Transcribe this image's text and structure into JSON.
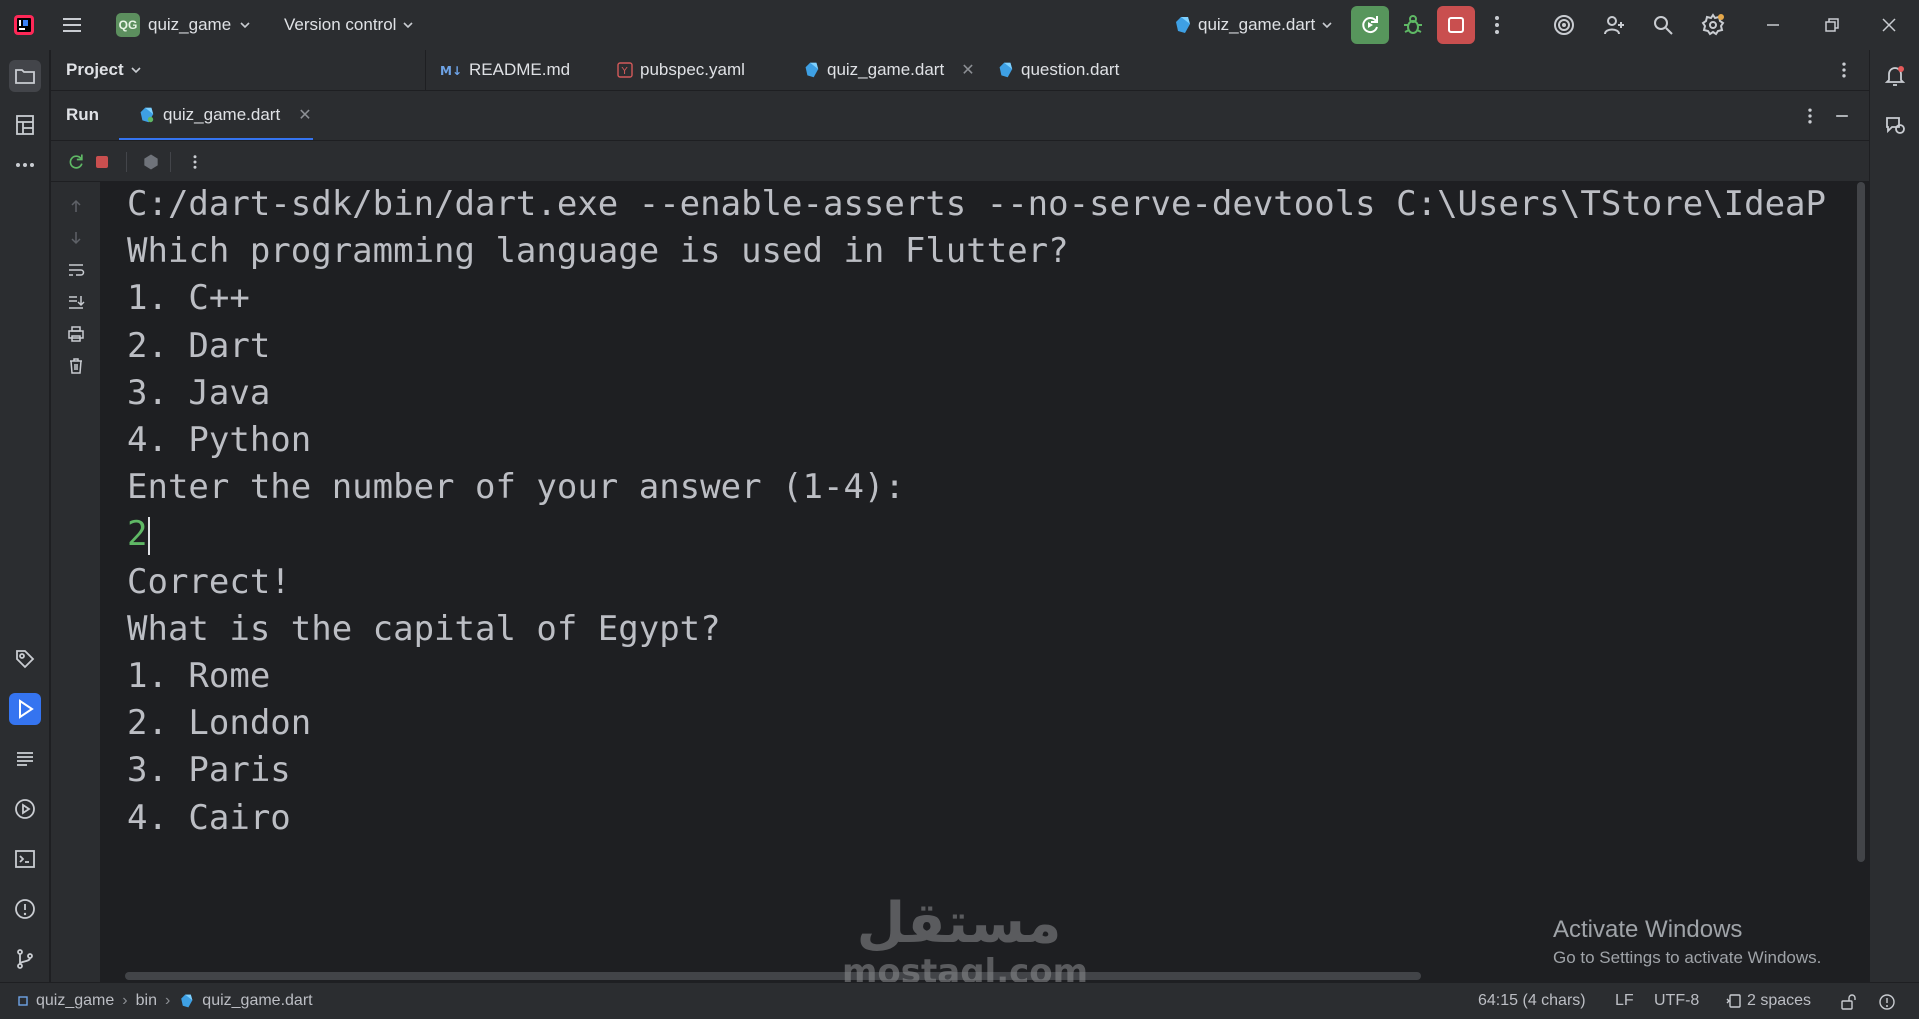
{
  "titlebar": {
    "project_badge": "QG",
    "project_name": "quiz_game",
    "vcs_label": "Version control",
    "run_config": "quiz_game.dart"
  },
  "project_panel": {
    "title": "Project"
  },
  "editor_tabs": [
    {
      "label": "README.md",
      "icon": "markdown-file-icon"
    },
    {
      "label": "pubspec.yaml",
      "icon": "yaml-file-icon"
    },
    {
      "label": "quiz_game.dart",
      "icon": "dart-file-icon",
      "active": true
    },
    {
      "label": "question.dart",
      "icon": "dart-file-icon"
    }
  ],
  "run_panel": {
    "title": "Run",
    "tab_label": "quiz_game.dart"
  },
  "console": {
    "lines": [
      {
        "text": "C:/dart-sdk/bin/dart.exe --enable-asserts --no-serve-devtools C:\\Users\\TStore\\IdeaP",
        "kind": "output"
      },
      {
        "text": "Which programming language is used in Flutter?",
        "kind": "output"
      },
      {
        "text": "1. C++",
        "kind": "output"
      },
      {
        "text": "2. Dart",
        "kind": "output"
      },
      {
        "text": "3. Java",
        "kind": "output"
      },
      {
        "text": "4. Python",
        "kind": "output"
      },
      {
        "text": "Enter the number of your answer (1-4):",
        "kind": "output"
      },
      {
        "text": "2",
        "kind": "input"
      },
      {
        "text": "Correct!",
        "kind": "output"
      },
      {
        "text": "What is the capital of Egypt?",
        "kind": "output"
      },
      {
        "text": "1. Rome",
        "kind": "output"
      },
      {
        "text": "2. London",
        "kind": "output"
      },
      {
        "text": "3. Paris",
        "kind": "output"
      },
      {
        "text": "4. Cairo",
        "kind": "output"
      }
    ]
  },
  "overlay": {
    "activate_title": "Activate Windows",
    "activate_sub": "Go to Settings to activate Windows.",
    "watermark_ar": "مستقل",
    "watermark_en": "mostaql.com"
  },
  "statusbar": {
    "crumbs": [
      "quiz_game",
      "bin",
      "quiz_game.dart"
    ],
    "position": "64:15 (4 chars)",
    "line_sep": "LF",
    "encoding": "UTF-8",
    "indent": "2 spaces"
  },
  "colors": {
    "accent": "#3574f0",
    "run_green": "#57965c",
    "stop_red": "#c94f4f",
    "input_green": "#5fb865"
  }
}
